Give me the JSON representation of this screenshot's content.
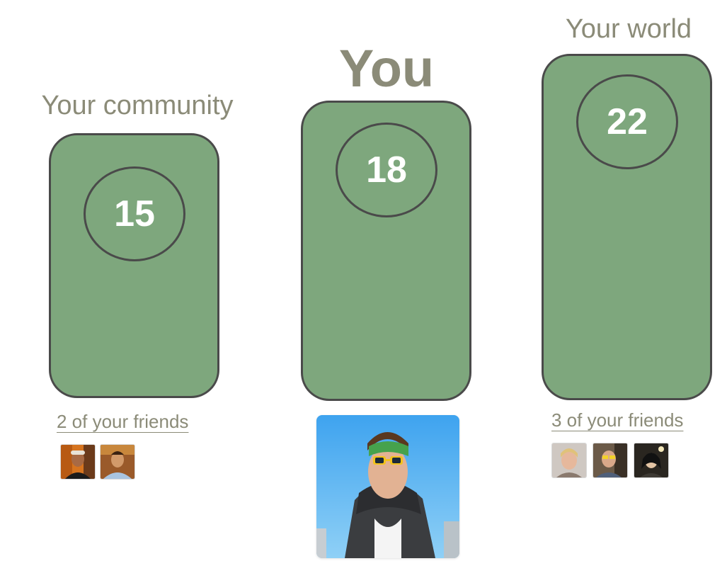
{
  "columns": {
    "community": {
      "heading": "Your community",
      "score": "15",
      "friends_link": "2 of your friends"
    },
    "you": {
      "heading": "You",
      "score": "18"
    },
    "world": {
      "heading": "Your world",
      "score": "22",
      "friends_link": "3 of your friends"
    }
  },
  "colors": {
    "pillar_fill": "#7ea77d",
    "pillar_border": "#4a4a4a",
    "heading_text": "#8b8b78",
    "score_text": "#ffffff"
  }
}
